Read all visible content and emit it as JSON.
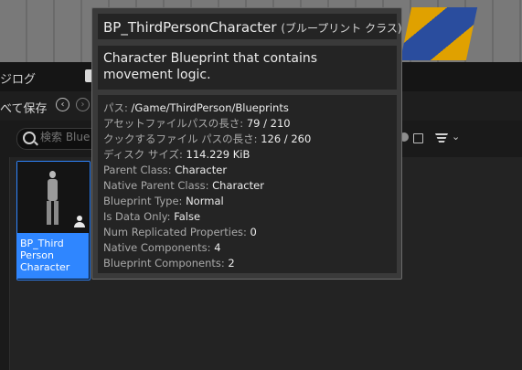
{
  "panel": {
    "tab_label": "ジログ",
    "save_all_label": "べて保存",
    "search": {
      "placeholder": "検索 Blue"
    }
  },
  "asset": {
    "label": "BP_Third Person Character",
    "selected_color": "#2f86ff"
  },
  "tooltip": {
    "title": "BP_ThirdPersonCharacter",
    "title_suffix": "(ブループリント クラス)",
    "description": "Character Blueprint that contains movement logic.",
    "properties": [
      {
        "key": "パス:",
        "value": "/Game/ThirdPerson/Blueprints"
      },
      {
        "key": "アセットファイルパスの長さ:",
        "value": "79 / 210"
      },
      {
        "key": "クックするファイル パスの長さ:",
        "value": "126 / 260"
      },
      {
        "key": "ディスク サイズ:",
        "value": "114.229 KiB"
      },
      {
        "key": "Parent Class:",
        "value": "Character"
      },
      {
        "key": "Native Parent Class:",
        "value": "Character"
      },
      {
        "key": "Blueprint Type:",
        "value": "Normal"
      },
      {
        "key": "Is Data Only:",
        "value": "False"
      },
      {
        "key": "Num Replicated Properties:",
        "value": "0"
      },
      {
        "key": "Native Components:",
        "value": "4"
      },
      {
        "key": "Blueprint Components:",
        "value": "2"
      }
    ]
  },
  "icons": {
    "back": "arrow-left-icon",
    "forward": "arrow-right-icon",
    "search": "search-icon",
    "filter": "filter-icon",
    "save_search": "save-icon",
    "character": "character-icon"
  }
}
